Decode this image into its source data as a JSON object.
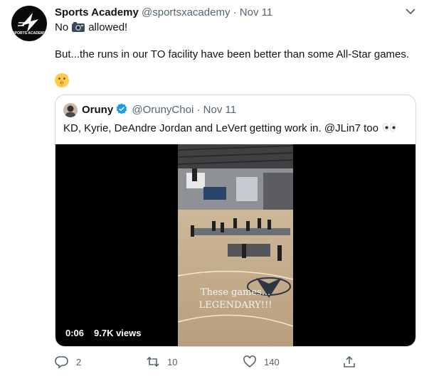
{
  "tweet": {
    "author_name": "Sports Academy",
    "handle": "@sportsxacademy",
    "separator": "·",
    "date": "Nov 11",
    "text_no": "No",
    "text_allowed": "allowed!",
    "text_body": "But...the runs in our TO facility have been better than some All-Star games.",
    "logo_text": "SPORTS ACADEMY"
  },
  "quoted": {
    "author_name": "Oruny",
    "handle": "@OrunyChoi",
    "separator": "·",
    "date": "Nov 11",
    "text": "KD, Kyrie, DeAndre Jordan and LeVert getting work in. @JLin7 too",
    "video": {
      "time": "0:06",
      "views": "9.7K views",
      "overlay_line1": "These games...",
      "overlay_line2": "LEGENDARY!!!"
    }
  },
  "actions": {
    "replies": "2",
    "retweets": "10",
    "likes": "140"
  },
  "icons": {
    "reply": "reply-icon",
    "retweet": "retweet-icon",
    "like": "heart-icon",
    "share": "share-icon",
    "more": "chevron-down-icon",
    "camera": "camera-emoji",
    "shush": "shushing-face-emoji",
    "eyes": "eyes-emoji",
    "verified": "verified-badge-icon"
  },
  "colors": {
    "text": "#0f1419",
    "muted": "#536471",
    "verified": "#1d9bf0",
    "border": "#cfd9de"
  }
}
